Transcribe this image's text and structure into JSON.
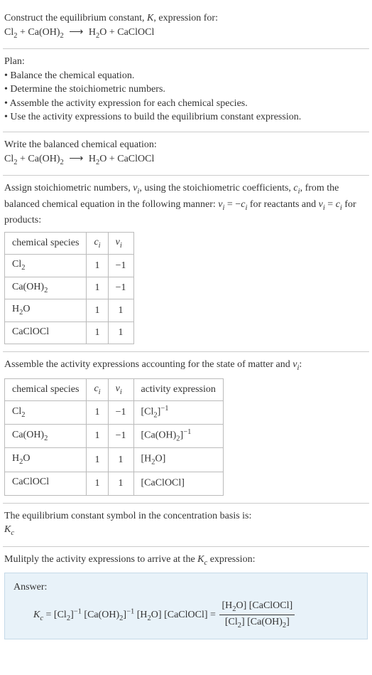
{
  "intro": {
    "line1_pre": "Construct the equilibrium constant, ",
    "line1_K": "K",
    "line1_post": ", expression for:",
    "eq_lhs_a": "Cl",
    "eq_sub_a": "2",
    "eq_plus1": " + ",
    "eq_lhs_b": "Ca(OH)",
    "eq_sub_b": "2",
    "eq_arrow": "⟶",
    "eq_rhs_a": "H",
    "eq_sub_c": "2",
    "eq_rhs_a2": "O",
    "eq_plus2": " + ",
    "eq_rhs_b": "CaClOCl"
  },
  "plan": {
    "title": "Plan:",
    "items": [
      "Balance the chemical equation.",
      "Determine the stoichiometric numbers.",
      "Assemble the activity expression for each chemical species.",
      "Use the activity expressions to build the equilibrium constant expression."
    ]
  },
  "balanced": {
    "title": "Write the balanced chemical equation:"
  },
  "assign": {
    "text_a": "Assign stoichiometric numbers, ",
    "nu": "ν",
    "sub_i": "i",
    "text_b": ", using the stoichiometric coefficients, ",
    "c": "c",
    "text_c": ", from the balanced chemical equation in the following manner: ",
    "eq1_l": "ν",
    "eq1_eq": " = −",
    "eq1_r": "c",
    "text_d": " for reactants and ",
    "eq2_l": "ν",
    "eq2_eq": " = ",
    "eq2_r": "c",
    "text_e": " for products:"
  },
  "table1": {
    "h1": "chemical species",
    "h2": "c",
    "h2s": "i",
    "h3": "ν",
    "h3s": "i",
    "rows": [
      {
        "sp_a": "Cl",
        "sp_sub": "2",
        "sp_b": "",
        "c": "1",
        "v": "−1"
      },
      {
        "sp_a": "Ca(OH)",
        "sp_sub": "2",
        "sp_b": "",
        "c": "1",
        "v": "−1"
      },
      {
        "sp_a": "H",
        "sp_sub": "2",
        "sp_b": "O",
        "c": "1",
        "v": "1"
      },
      {
        "sp_a": "CaClOCl",
        "sp_sub": "",
        "sp_b": "",
        "c": "1",
        "v": "1"
      }
    ]
  },
  "assemble": {
    "text_a": "Assemble the activity expressions accounting for the state of matter and ",
    "nu": "ν",
    "sub_i": "i",
    "text_b": ":"
  },
  "table2": {
    "h1": "chemical species",
    "h2": "c",
    "h2s": "i",
    "h3": "ν",
    "h3s": "i",
    "h4": "activity expression",
    "rows": [
      {
        "sp_a": "Cl",
        "sp_sub": "2",
        "sp_b": "",
        "c": "1",
        "v": "−1",
        "ae_a": "[Cl",
        "ae_sub": "2",
        "ae_b": "]",
        "ae_sup": "−1"
      },
      {
        "sp_a": "Ca(OH)",
        "sp_sub": "2",
        "sp_b": "",
        "c": "1",
        "v": "−1",
        "ae_a": "[Ca(OH)",
        "ae_sub": "2",
        "ae_b": "]",
        "ae_sup": "−1"
      },
      {
        "sp_a": "H",
        "sp_sub": "2",
        "sp_b": "O",
        "c": "1",
        "v": "1",
        "ae_a": "[H",
        "ae_sub": "2",
        "ae_b": "O]",
        "ae_sup": ""
      },
      {
        "sp_a": "CaClOCl",
        "sp_sub": "",
        "sp_b": "",
        "c": "1",
        "v": "1",
        "ae_a": "[CaClOCl]",
        "ae_sub": "",
        "ae_b": "",
        "ae_sup": ""
      }
    ]
  },
  "symbol": {
    "line1": "The equilibrium constant symbol in the concentration basis is:",
    "K": "K",
    "sub": "c"
  },
  "multiply": {
    "text_a": "Mulitply the activity expressions to arrive at the ",
    "K": "K",
    "sub": "c",
    "text_b": " expression:"
  },
  "answer": {
    "label": "Answer:",
    "K": "K",
    "Ksub": "c",
    "eq": " = ",
    "t1a": "[Cl",
    "t1s": "2",
    "t1b": "]",
    "t1sup": "−1",
    "sp1": " ",
    "t2a": "[Ca(OH)",
    "t2s": "2",
    "t2b": "]",
    "t2sup": "−1",
    "sp2": " ",
    "t3a": "[H",
    "t3s": "2",
    "t3b": "O]",
    "sp3": " ",
    "t4": "[CaClOCl]",
    "eq2": " = ",
    "num_a": "[H",
    "num_s": "2",
    "num_b": "O] [CaClOCl]",
    "den_a": "[Cl",
    "den_s1": "2",
    "den_b": "] [Ca(OH)",
    "den_s2": "2",
    "den_c": "]"
  }
}
